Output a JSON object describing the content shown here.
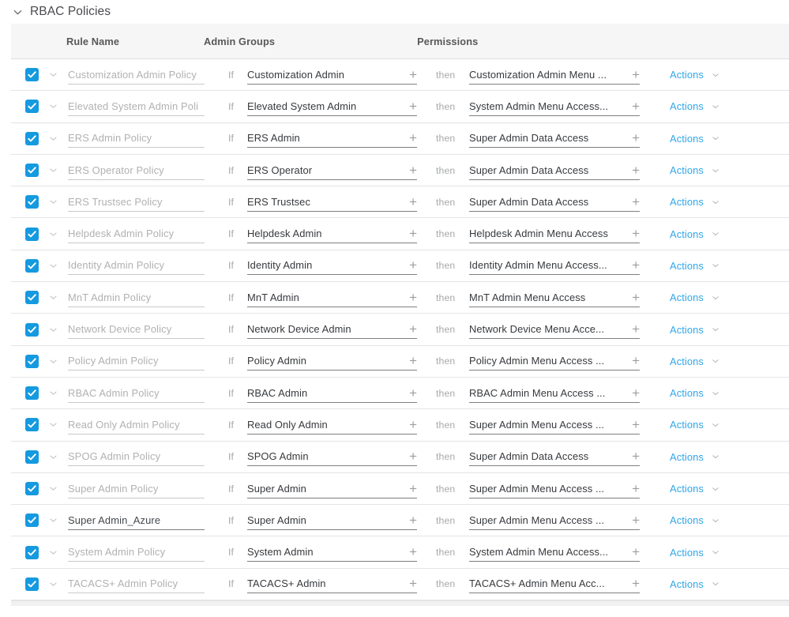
{
  "section": {
    "title": "RBAC Policies",
    "collapse_icon": "chevron-down-icon",
    "expanded": true
  },
  "table": {
    "columns": {
      "rule_name": "Rule Name",
      "admin_groups": "Admin Groups",
      "permissions": "Permissions"
    },
    "connectors": {
      "if": "If",
      "then": "then"
    },
    "actions_label": "Actions",
    "add_icon": "plus-icon",
    "row_expand_icon": "chevron-down-icon",
    "actions_icon": "chevron-down-icon",
    "checkbox_icon": "check-icon",
    "colors": {
      "checkbox": "#159ae0",
      "link": "#31a6e8",
      "header_bg": "#f6f6f6",
      "placeholder_text": "#b1b1b3",
      "value_text": "#36393d",
      "connector_text": "#a6a8ab"
    },
    "rows": [
      {
        "checked": true,
        "rule_name": "Customization Admin Policy",
        "rule_name_is_placeholder": true,
        "admin_group": "Customization Admin",
        "permission": "Customization Admin Menu ..."
      },
      {
        "checked": true,
        "rule_name": "Elevated System Admin Poli",
        "rule_name_is_placeholder": true,
        "admin_group": "Elevated System Admin",
        "permission": "System Admin Menu Access..."
      },
      {
        "checked": true,
        "rule_name": "ERS Admin Policy",
        "rule_name_is_placeholder": true,
        "admin_group": "ERS Admin",
        "permission": "Super Admin Data Access"
      },
      {
        "checked": true,
        "rule_name": "ERS Operator Policy",
        "rule_name_is_placeholder": true,
        "admin_group": "ERS Operator",
        "permission": "Super Admin Data Access"
      },
      {
        "checked": true,
        "rule_name": "ERS Trustsec Policy",
        "rule_name_is_placeholder": true,
        "admin_group": "ERS Trustsec",
        "permission": "Super Admin Data Access"
      },
      {
        "checked": true,
        "rule_name": "Helpdesk Admin Policy",
        "rule_name_is_placeholder": true,
        "admin_group": "Helpdesk Admin",
        "permission": "Helpdesk Admin Menu Access"
      },
      {
        "checked": true,
        "rule_name": "Identity Admin Policy",
        "rule_name_is_placeholder": true,
        "admin_group": "Identity Admin",
        "permission": "Identity Admin Menu Access..."
      },
      {
        "checked": true,
        "rule_name": "MnT Admin Policy",
        "rule_name_is_placeholder": true,
        "admin_group": "MnT Admin",
        "permission": "MnT Admin Menu Access"
      },
      {
        "checked": true,
        "rule_name": "Network Device Policy",
        "rule_name_is_placeholder": true,
        "admin_group": "Network Device Admin",
        "permission": "Network Device Menu Acce..."
      },
      {
        "checked": true,
        "rule_name": "Policy Admin Policy",
        "rule_name_is_placeholder": true,
        "admin_group": "Policy Admin",
        "permission": "Policy Admin Menu Access ..."
      },
      {
        "checked": true,
        "rule_name": "RBAC Admin Policy",
        "rule_name_is_placeholder": true,
        "admin_group": "RBAC Admin",
        "permission": "RBAC Admin Menu Access ..."
      },
      {
        "checked": true,
        "rule_name": "Read Only Admin Policy",
        "rule_name_is_placeholder": true,
        "admin_group": "Read Only Admin",
        "permission": "Super Admin Menu Access ..."
      },
      {
        "checked": true,
        "rule_name": "SPOG Admin Policy",
        "rule_name_is_placeholder": true,
        "admin_group": "SPOG Admin",
        "permission": "Super Admin Data Access"
      },
      {
        "checked": true,
        "rule_name": "Super Admin Policy",
        "rule_name_is_placeholder": true,
        "admin_group": "Super Admin",
        "permission": "Super Admin Menu Access ..."
      },
      {
        "checked": true,
        "rule_name": "Super Admin_Azure",
        "rule_name_is_placeholder": false,
        "admin_group": "Super Admin",
        "permission": "Super Admin Menu Access ..."
      },
      {
        "checked": true,
        "rule_name": "System Admin Policy",
        "rule_name_is_placeholder": true,
        "admin_group": "System Admin",
        "permission": "System Admin Menu Access..."
      },
      {
        "checked": true,
        "rule_name": "TACACS+ Admin Policy",
        "rule_name_is_placeholder": true,
        "admin_group": "TACACS+ Admin",
        "permission": "TACACS+ Admin Menu Acc..."
      }
    ]
  }
}
